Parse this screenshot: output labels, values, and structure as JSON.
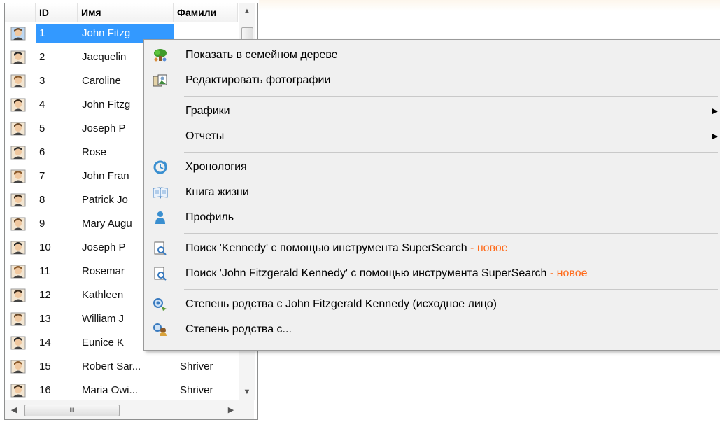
{
  "table": {
    "headers": {
      "id": "ID",
      "first": "Имя",
      "last": "Фамили"
    },
    "rows": [
      {
        "id": "1",
        "first": "John Fitzg",
        "last": ""
      },
      {
        "id": "2",
        "first": "Jacquelin",
        "last": ""
      },
      {
        "id": "3",
        "first": "Caroline",
        "last": ""
      },
      {
        "id": "4",
        "first": "John Fitzg",
        "last": ""
      },
      {
        "id": "5",
        "first": "Joseph P",
        "last": ""
      },
      {
        "id": "6",
        "first": "Rose",
        "last": ""
      },
      {
        "id": "7",
        "first": "John Fran",
        "last": ""
      },
      {
        "id": "8",
        "first": "Patrick Jo",
        "last": ""
      },
      {
        "id": "9",
        "first": "Mary Augu",
        "last": ""
      },
      {
        "id": "10",
        "first": "Joseph P",
        "last": ""
      },
      {
        "id": "11",
        "first": "Rosemar",
        "last": ""
      },
      {
        "id": "12",
        "first": "Kathleen",
        "last": ""
      },
      {
        "id": "13",
        "first": "William J",
        "last": ""
      },
      {
        "id": "14",
        "first": "Eunice K",
        "last": ""
      },
      {
        "id": "15",
        "first": "Robert Sar...",
        "last": "Shriver"
      },
      {
        "id": "16",
        "first": "Maria Owi...",
        "last": "Shriver"
      }
    ],
    "selected_row_id": "1",
    "scrollbar_glyphs": {
      "up": "▲",
      "down": "▼",
      "left": "◀",
      "right": "▶",
      "grip": "III"
    }
  },
  "menu": {
    "items": {
      "family_tree": "Показать в семейном дереве",
      "edit_photos": "Редактировать фотографии",
      "charts": "Графики",
      "reports": "Отчеты",
      "timeline": "Хронология",
      "book_of_life": "Книга жизни",
      "profile": "Профиль",
      "supersearch_surname": "Поиск 'Kennedy' с помощью инструмента SuperSearch",
      "supersearch_fullname": "Поиск 'John Fitzgerald Kennedy' с помощью инструмента SuperSearch",
      "new_badge": " - новое",
      "relationship_root": "Степень родства с John Fitzgerald Kennedy (исходное лицо)",
      "relationship_with": "Степень родства с..."
    },
    "submenu_arrow": "▶",
    "icons": {
      "family_tree": "tree-icon",
      "edit_photos": "photos-icon",
      "timeline": "timeline-icon",
      "book_of_life": "book-icon",
      "profile": "person-icon",
      "supersearch": "search-document-icon",
      "relationship_root": "relationship-icon",
      "relationship_with": "relationship-people-icon"
    }
  },
  "colors": {
    "selection": "#3399ff",
    "new_badge": "#ff6a1a",
    "menu_background": "#f0f0f0"
  }
}
